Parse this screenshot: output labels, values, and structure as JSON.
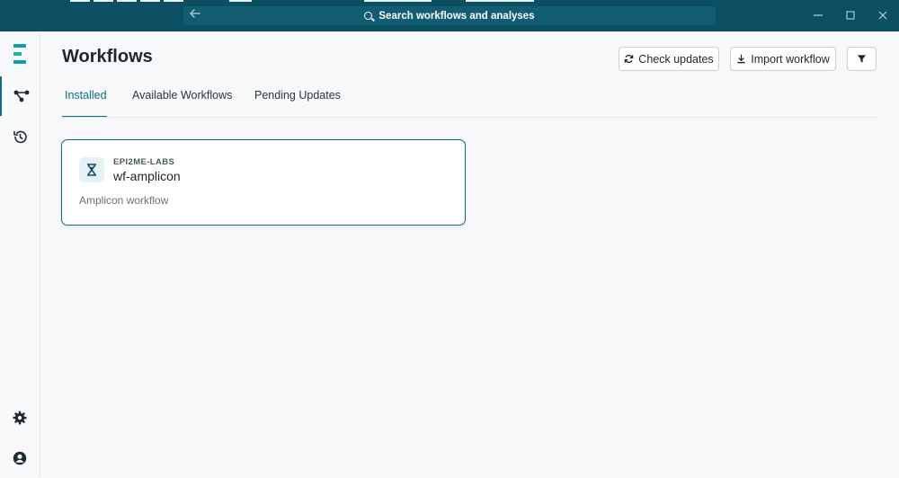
{
  "titlebar": {
    "search_placeholder": "Search workflows and analyses",
    "back_icon": "arrow-left-icon",
    "window_controls": [
      "minimize-icon",
      "maximize-icon",
      "close-icon"
    ],
    "background": "#0a4f62"
  },
  "sidebar": {
    "logo_colors": [
      "#0d9fb8",
      "#1fb5a3",
      "#f0a020"
    ],
    "items": [
      {
        "name": "workflows",
        "icon": "workflow-graph-icon",
        "active": true
      },
      {
        "name": "history",
        "icon": "history-icon",
        "active": false
      }
    ],
    "bottom_items": [
      {
        "name": "settings",
        "icon": "gear-icon"
      },
      {
        "name": "account",
        "icon": "user-circle-icon"
      }
    ]
  },
  "main": {
    "title": "Workflows",
    "buttons": {
      "check_updates": "Check updates",
      "import_workflow": "Import workflow",
      "filter_icon": "filter-icon"
    },
    "tabs": [
      {
        "label": "Installed",
        "active": true
      },
      {
        "label": "Available Workflows",
        "active": false
      },
      {
        "label": "Pending Updates",
        "active": false
      }
    ],
    "workflows": [
      {
        "org": "EPI2ME-LABS",
        "name": "wf-amplicon",
        "description": "Amplicon workflow",
        "icon": "hourglass-icon"
      }
    ]
  },
  "colors": {
    "accent": "#0a6f8a",
    "card_border": "#0f6b85"
  }
}
